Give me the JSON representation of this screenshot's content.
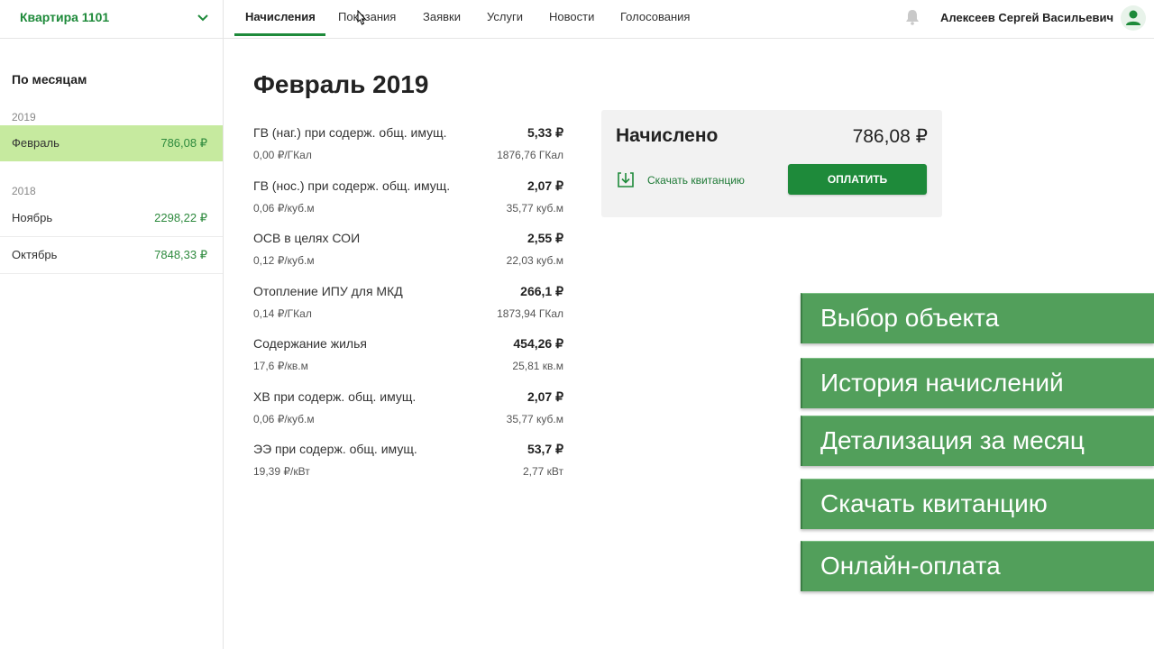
{
  "sidebar": {
    "apartment_label": "Квартира 1101",
    "heading": "По месяцам",
    "groups": [
      {
        "year": "2019",
        "months": [
          {
            "name": "Февраль",
            "sum": "786,08 ₽"
          }
        ]
      },
      {
        "year": "2018",
        "months": [
          {
            "name": "Ноябрь",
            "sum": "2298,22 ₽"
          },
          {
            "name": "Октябрь",
            "sum": "7848,33 ₽"
          }
        ]
      }
    ]
  },
  "nav": {
    "tabs": [
      "Начисления",
      "Показания",
      "Заявки",
      "Услуги",
      "Новости",
      "Голосования"
    ],
    "user_name": "Алексеев Сергей Васильевич"
  },
  "main": {
    "title": "Февраль 2019",
    "charges": [
      {
        "name": "ГВ (наг.) при содерж. общ. имущ.",
        "amount": "5,33 ₽",
        "rate": "0,00 ₽/ГКал",
        "volume": "1876,76 ГКал"
      },
      {
        "name": "ГВ (нос.) при содерж. общ. имущ.",
        "amount": "2,07 ₽",
        "rate": "0,06 ₽/куб.м",
        "volume": "35,77 куб.м"
      },
      {
        "name": "ОСВ в целях СОИ",
        "amount": "2,55 ₽",
        "rate": "0,12 ₽/куб.м",
        "volume": "22,03 куб.м"
      },
      {
        "name": "Отопление ИПУ для МКД",
        "amount": "266,1 ₽",
        "rate": "0,14 ₽/ГКал",
        "volume": "1873,94 ГКал"
      },
      {
        "name": "Содержание жилья",
        "amount": "454,26 ₽",
        "rate": "17,6 ₽/кв.м",
        "volume": "25,81 кв.м"
      },
      {
        "name": "ХВ при содерж. общ. имущ.",
        "amount": "2,07 ₽",
        "rate": "0,06 ₽/куб.м",
        "volume": "35,77 куб.м"
      },
      {
        "name": "ЭЭ при содерж. общ. имущ.",
        "amount": "53,7 ₽",
        "rate": "19,39 ₽/кВт",
        "volume": "2,77 кВт"
      }
    ],
    "summary": {
      "title": "Начислено",
      "total": "786,08 ₽",
      "download_label": "Скачать квитанцию",
      "pay_label": "ОПЛАТИТЬ"
    }
  },
  "features": [
    "Выбор объекта",
    "История начислений",
    "Детализация за месяц",
    "Скачать квитанцию",
    "Онлайн-оплата"
  ],
  "colors": {
    "brand_green": "#1e8a3a",
    "active_month_bg": "#c6ea9f",
    "feature_bg": "#529f5b"
  }
}
